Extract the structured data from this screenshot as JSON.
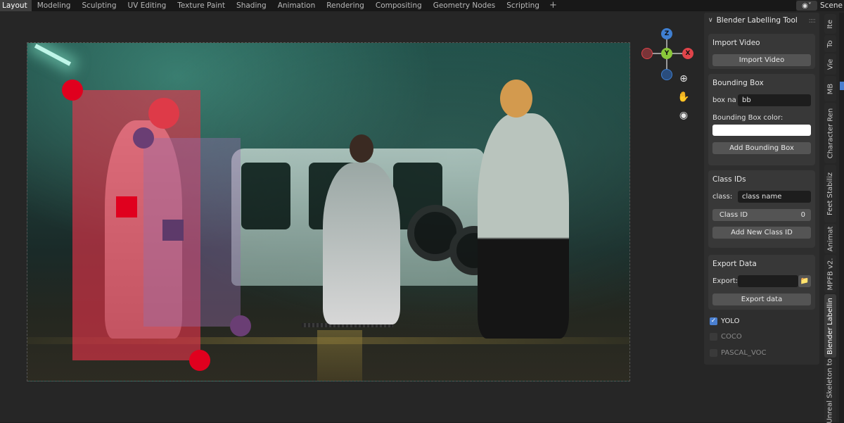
{
  "workspace_tabs": [
    "Layout",
    "Modeling",
    "Sculpting",
    "UV Editing",
    "Texture Paint",
    "Shading",
    "Animation",
    "Rendering",
    "Compositing",
    "Geometry Nodes",
    "Scripting"
  ],
  "add_tab": "+",
  "scene": {
    "label": "Scene",
    "icon": "scene-icon"
  },
  "gizmo": {
    "z": "Z",
    "y": "Y",
    "x": "X",
    "colors": {
      "x": "#e0444a",
      "y": "#8ac83a",
      "z": "#3f7fd1"
    }
  },
  "nav_icons": [
    "zoom-icon",
    "hand-icon",
    "camera-icon"
  ],
  "annotations": {
    "box_red_color": "#e8334a",
    "box_purple_color": "#8a5a9a",
    "handle_red": "#e0001e",
    "handle_purple": "#6a3e74"
  },
  "panel": {
    "title": "Blender Labelling Tool",
    "import": {
      "title": "Import Video",
      "button": "Import Video"
    },
    "bbox": {
      "title": "Bounding Box",
      "name_label": "box na",
      "name_value": "bb",
      "color_label": "Bounding Box color:",
      "color_value": "#ffffff",
      "add_button": "Add Bounding Box"
    },
    "class_ids": {
      "title": "Class IDs",
      "class_label": "class:",
      "class_placeholder": "class name",
      "id_label": "Class ID",
      "id_value": "0",
      "add_button": "Add New Class ID"
    },
    "export": {
      "title": "Export Data",
      "export_label": "Export:",
      "export_value": "",
      "button": "Export data"
    },
    "formats": [
      {
        "label": "YOLO",
        "checked": true
      },
      {
        "label": "COCO",
        "checked": false
      },
      {
        "label": "PASCAL_VOC",
        "checked": false
      }
    ]
  },
  "side_tabs": [
    "Ite",
    "To",
    "Vie",
    "MB",
    "Character Ren",
    "Feet Stabiliz",
    "Animat",
    "MPFB v2.",
    "Blender Labellin",
    "Unreal Skeleton to"
  ]
}
